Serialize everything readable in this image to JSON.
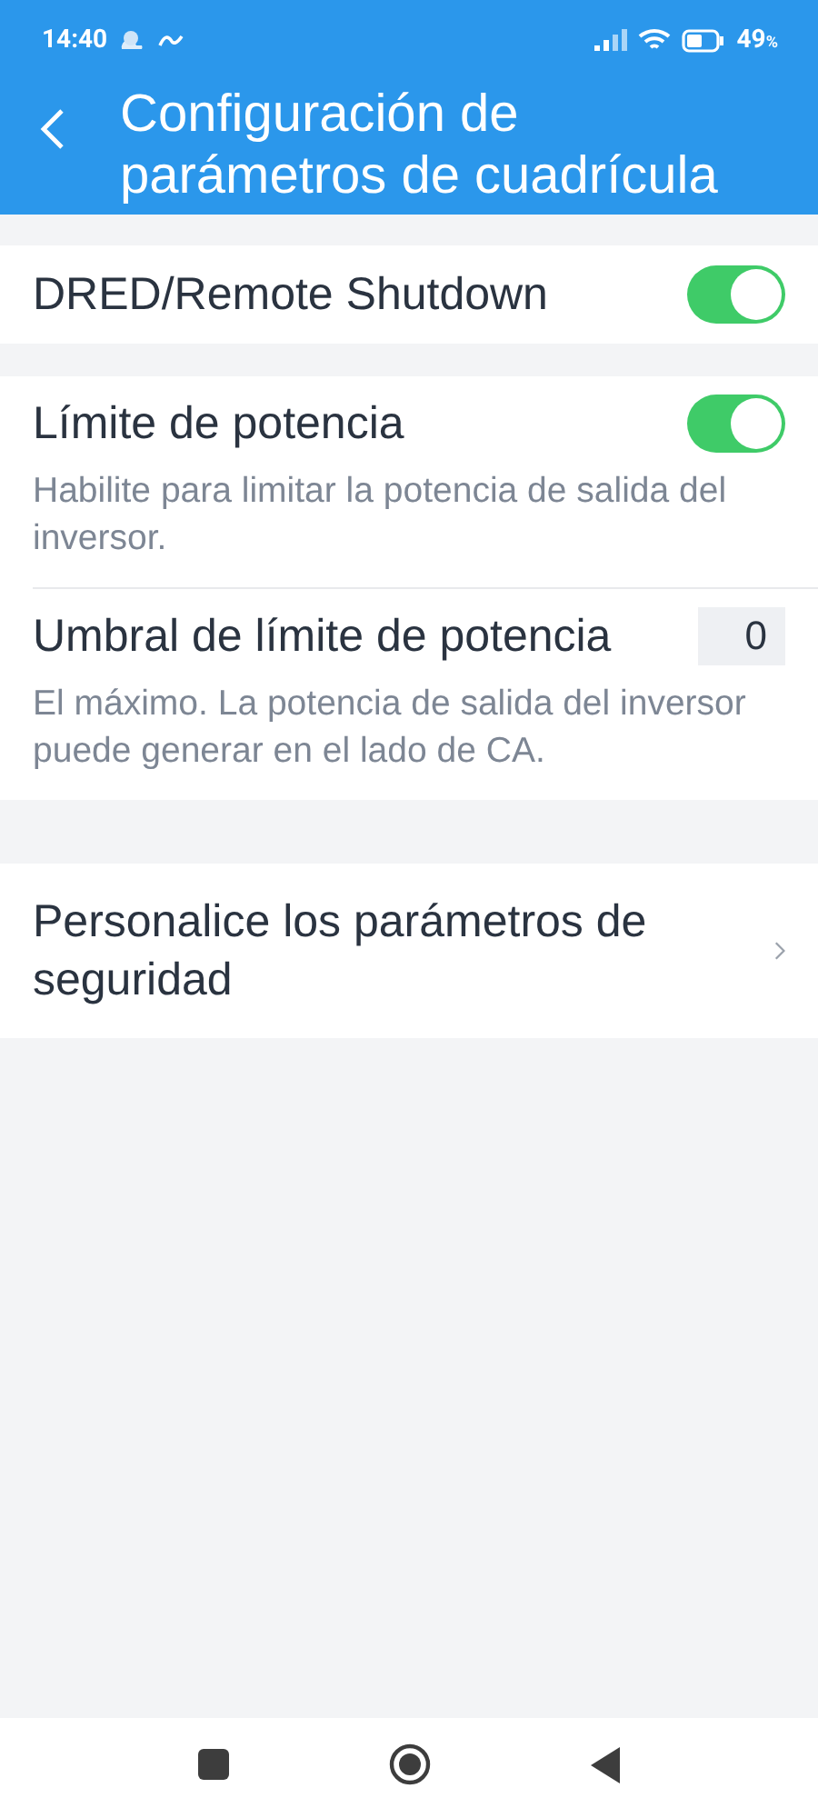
{
  "status_bar": {
    "time": "14:40",
    "battery": "49",
    "battery_unit": "%"
  },
  "header": {
    "title": "Configuración de parámetros de cuadrícula"
  },
  "sections": [
    {
      "rows": [
        {
          "kind": "toggle",
          "label": "DRED/Remote Shutdown",
          "on": true
        }
      ]
    },
    {
      "rows": [
        {
          "kind": "toggle",
          "label": "Límite de potencia",
          "on": true,
          "description": "Habilite para limitar la potencia de salida del inversor."
        },
        {
          "kind": "value",
          "label": "Umbral de límite de potencia",
          "value": "0",
          "description": "El máximo. La potencia de salida del inversor puede generar en el lado de CA."
        }
      ]
    },
    {
      "rows": [
        {
          "kind": "link",
          "label": "Personalice los parámetros de seguridad"
        }
      ]
    }
  ]
}
